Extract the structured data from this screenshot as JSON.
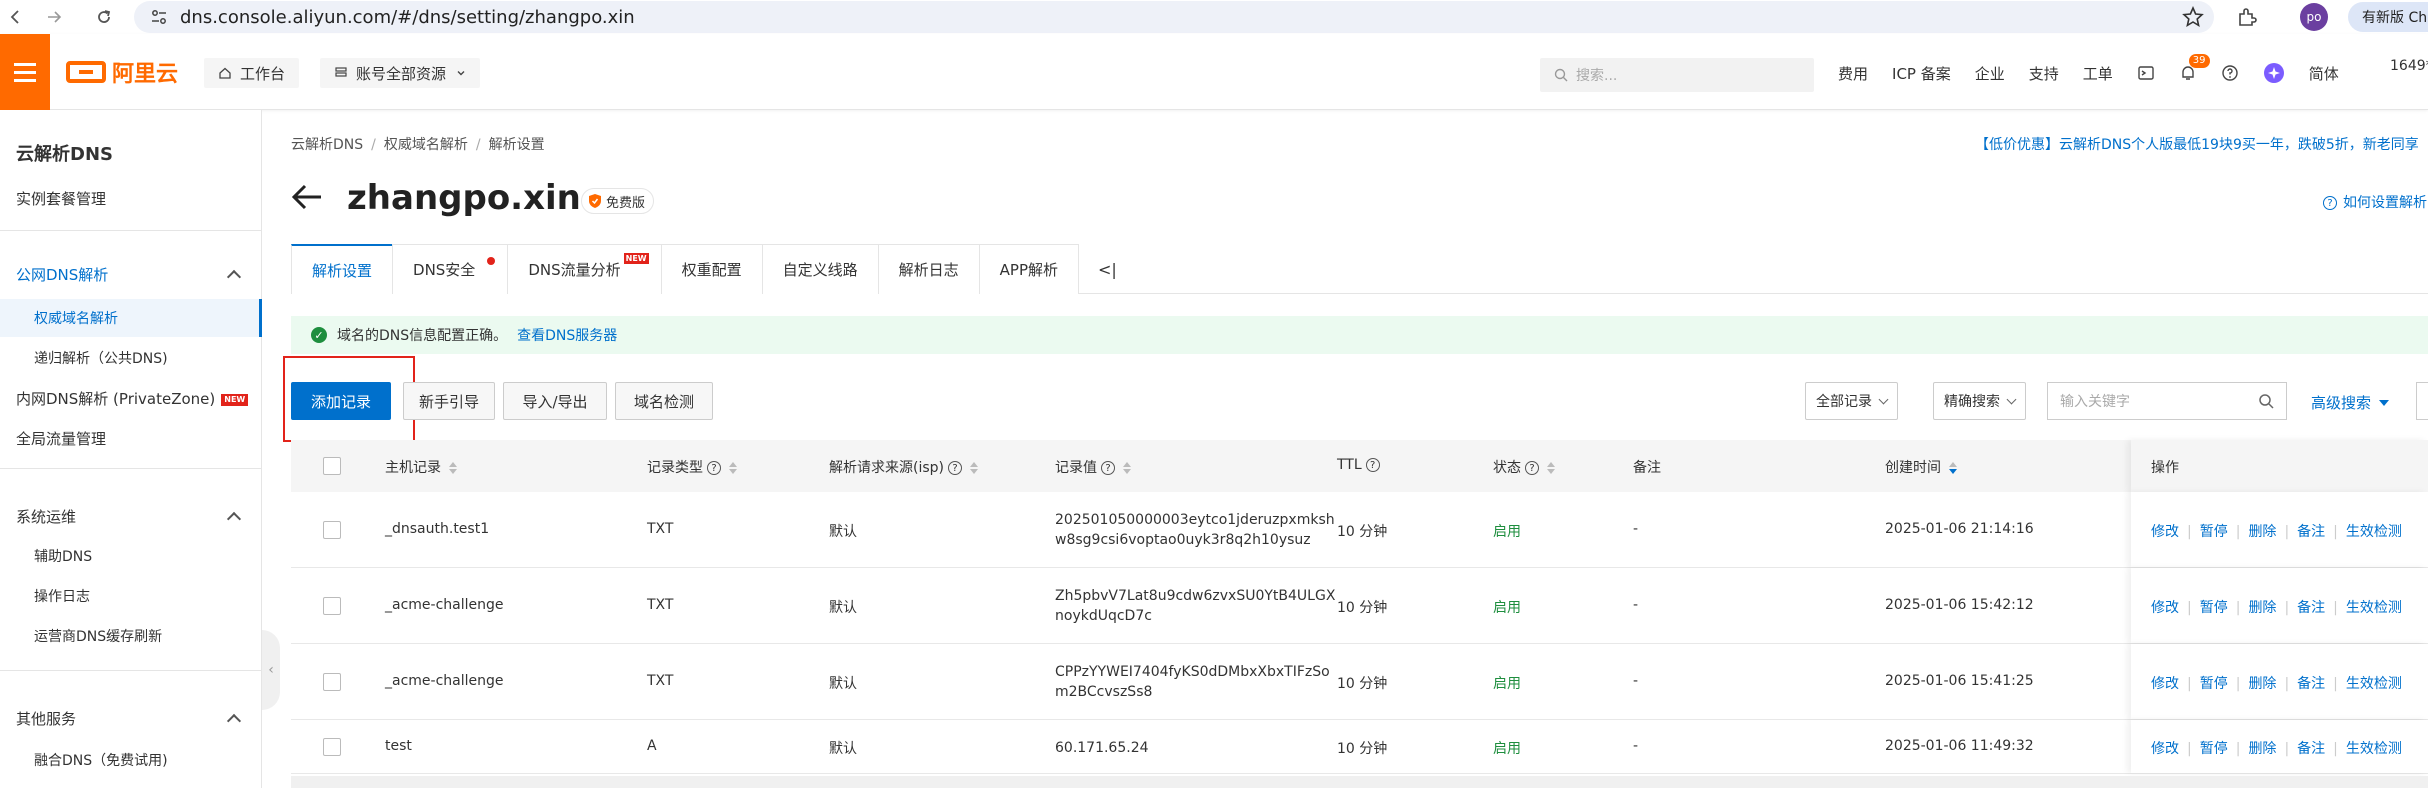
{
  "browser": {
    "url": "dns.console.aliyun.com/#/dns/setting/zhangpo.xin",
    "profile_initials": "po",
    "new_version_label": "有新版 Ch"
  },
  "topbar": {
    "logo_text": "阿里云",
    "workbench_label": "工作台",
    "resource_label": "账号全部资源",
    "search_placeholder": "搜索...",
    "links": [
      "费用",
      "ICP 备案",
      "企业",
      "支持",
      "工单"
    ],
    "notification_count": "39",
    "language_label": "简体",
    "account_label": "1649*"
  },
  "sidebar": {
    "title": "云解析DNS",
    "instance_label": "实例套餐管理",
    "section_public": "公网DNS解析",
    "authoritative": "权威域名解析",
    "recursive": "递归解析（公共DNS)",
    "private_dns": "内网DNS解析 (PrivateZone)",
    "new_tag": "NEW",
    "global_traffic": "全局流量管理",
    "section_ops": "系统运维",
    "aux_dns": "辅助DNS",
    "op_log": "操作日志",
    "isp_refresh": "运营商DNS缓存刷新",
    "section_other": "其他服务",
    "fusion_dns": "融合DNS（免费试用)"
  },
  "main": {
    "breadcrumb": [
      "云解析DNS",
      "权威域名解析",
      "解析设置"
    ],
    "promo": "【低价优惠】云解析DNS个人版最低19块9买一年，跌破5折，新老同享",
    "domain": "zhangpo.xin",
    "plan_badge": "免费版",
    "help_link": "如何设置解析",
    "tabs": [
      "解析设置",
      "DNS安全",
      "DNS流量分析",
      "权重配置",
      "自定义线路",
      "解析日志",
      "APP解析"
    ],
    "tab_new_tag": "NEW",
    "tab_more": "<|",
    "alert_text": "域名的DNS信息配置正确。",
    "alert_link": "查看DNS服务器",
    "toolbar": {
      "add_record": "添加记录",
      "guide": "新手引导",
      "import_export": "导入/导出",
      "domain_check": "域名检测",
      "all_records": "全部记录",
      "exact_search": "精确搜索",
      "keyword_placeholder": "输入关键字",
      "advanced_search": "高级搜索"
    },
    "table": {
      "headers": {
        "host": "主机记录",
        "type": "记录类型",
        "source": "解析请求来源(isp)",
        "value": "记录值",
        "ttl": "TTL",
        "status": "状态",
        "remark": "备注",
        "created": "创建时间",
        "ops": "操作"
      },
      "rows": [
        {
          "host": "_dnsauth.test1",
          "type": "TXT",
          "source": "默认",
          "value1": "202501050000003eytco1jderuzpxmksh",
          "value2": "w8sg9csi6voptao0uyk3r8q2h10ysuz",
          "ttl": "10 分钟",
          "status": "启用",
          "remark": "-",
          "created": "2025-01-06 21:14:16"
        },
        {
          "host": "_acme-challenge",
          "type": "TXT",
          "source": "默认",
          "value1": "Zh5pbvV7Lat8u9cdw6zvxSU0YtB4ULGX",
          "value2": "noykdUqcD7c",
          "ttl": "10 分钟",
          "status": "启用",
          "remark": "-",
          "created": "2025-01-06 15:42:12"
        },
        {
          "host": "_acme-challenge",
          "type": "TXT",
          "source": "默认",
          "value1": "CPPzYYWEI7404fyKS0dDMbxXbxTIFzSo",
          "value2": "m2BCcvszSs8",
          "ttl": "10 分钟",
          "status": "启用",
          "remark": "-",
          "created": "2025-01-06 15:41:25"
        },
        {
          "host": "test",
          "type": "A",
          "source": "默认",
          "value1": "60.171.65.24",
          "value2": "",
          "ttl": "10 分钟",
          "status": "启用",
          "remark": "-",
          "created": "2025-01-06 11:49:32"
        }
      ],
      "ops": [
        "修改",
        "暂停",
        "删除",
        "备注",
        "生效检测"
      ]
    }
  },
  "colors": {
    "brand": "#ff6a00",
    "primary": "#0070cc",
    "success": "#1e8e3e",
    "danger": "#e2231a"
  }
}
